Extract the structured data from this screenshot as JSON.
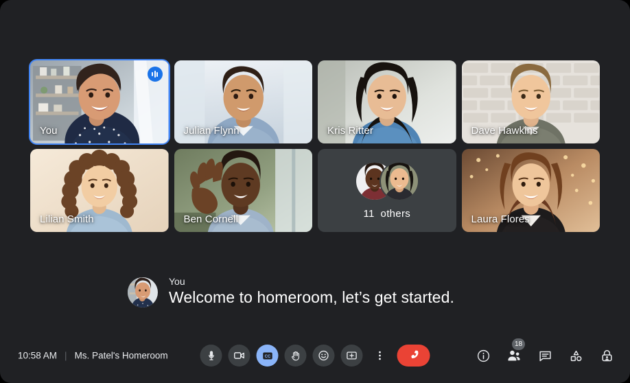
{
  "meeting": {
    "time": "10:58 AM",
    "separator": "|",
    "title": "Ms. Patel's Homeroom"
  },
  "grid": {
    "tiles": [
      {
        "name": "You",
        "type": "video",
        "active": true,
        "speaking": true,
        "bg": "#b9c4cc"
      },
      {
        "name": "Julian Flynn",
        "type": "video",
        "active": false,
        "speaking": false,
        "bg": "#c8d2dd"
      },
      {
        "name": "Kris Ritter",
        "type": "video",
        "active": false,
        "speaking": false,
        "bg": "#cfd6d8"
      },
      {
        "name": "Dave Hawkins",
        "type": "video",
        "active": false,
        "speaking": false,
        "bg": "#d8d3cd"
      },
      {
        "name": "Lilian Smith",
        "type": "video",
        "active": false,
        "speaking": false,
        "bg": "#e8d9c8"
      },
      {
        "name": "Ben Cornell",
        "type": "video",
        "active": false,
        "speaking": false,
        "bg": "#9aa79b"
      },
      {
        "name": "Laura Flores",
        "type": "video",
        "active": false,
        "speaking": false,
        "bg": "#c9a58c"
      }
    ],
    "others": {
      "count": "11",
      "label": "others"
    }
  },
  "caption": {
    "speaker": "You",
    "text": "Welcome to homeroom, let’s get started."
  },
  "controls": [
    {
      "name": "microphone-button",
      "icon": "mic-icon",
      "state": "off"
    },
    {
      "name": "camera-button",
      "icon": "camera-icon",
      "state": "off"
    },
    {
      "name": "captions-button",
      "icon": "cc-icon",
      "state": "active"
    },
    {
      "name": "raise-hand-button",
      "icon": "hand-icon",
      "state": "off"
    },
    {
      "name": "reactions-button",
      "icon": "emoji-icon",
      "state": "off"
    },
    {
      "name": "present-button",
      "icon": "present-icon",
      "state": "off"
    },
    {
      "name": "more-options-button",
      "icon": "kebab-menu-icon",
      "state": "plain"
    },
    {
      "name": "end-call-button",
      "icon": "end-call-icon",
      "state": "end"
    }
  ],
  "right_icons": [
    {
      "name": "meeting-details-button",
      "icon": "info-icon",
      "badge": ""
    },
    {
      "name": "participants-button",
      "icon": "people-icon",
      "badge": "18"
    },
    {
      "name": "chat-button",
      "icon": "chat-icon",
      "badge": ""
    },
    {
      "name": "activities-button",
      "icon": "activities-icon",
      "badge": ""
    },
    {
      "name": "host-controls-button",
      "icon": "host-lock-icon",
      "badge": ""
    }
  ],
  "colors": {
    "accent_blue": "#8ab4f8",
    "active_border": "#4285f4",
    "end_call_red": "#ea4335",
    "screen_bg": "#202124",
    "tile_bg": "#3c4043"
  }
}
